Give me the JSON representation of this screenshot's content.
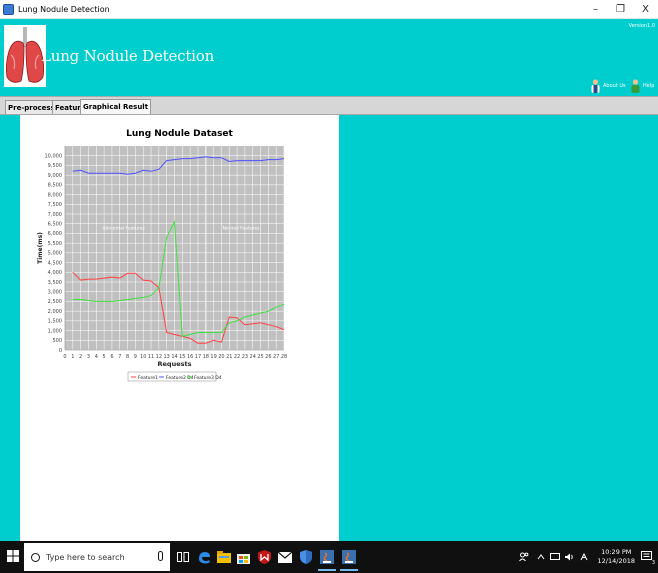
{
  "window": {
    "title": "Lung Nodule Detection",
    "controls": [
      "–",
      "❐",
      "X"
    ]
  },
  "header": {
    "version": "Version1.0",
    "app_title": "Lung Nodule Detection",
    "about_label": "About Us",
    "help_label": "Help"
  },
  "tabs": [
    {
      "label": "Pre-processing",
      "active": false
    },
    {
      "label": "Features",
      "active": false
    },
    {
      "label": "Graphical Result",
      "active": true
    }
  ],
  "chart_data": {
    "type": "line",
    "title": "Lung Nodule Dataset",
    "xlabel": "Requests",
    "ylabel": "Time(ms)",
    "xlim": [
      0,
      28
    ],
    "ylim": [
      0,
      10500
    ],
    "x_ticks": [
      0,
      1,
      2,
      3,
      4,
      5,
      6,
      7,
      8,
      9,
      10,
      11,
      12,
      13,
      14,
      15,
      16,
      17,
      18,
      19,
      20,
      21,
      22,
      23,
      24,
      25,
      26,
      27,
      28
    ],
    "y_ticks": [
      0,
      500,
      1000,
      1500,
      2000,
      2500,
      3000,
      3500,
      4000,
      4500,
      5000,
      5500,
      6000,
      6500,
      7000,
      7500,
      8000,
      8500,
      9000,
      9500,
      10000
    ],
    "y_tick_labels": [
      "0",
      "500",
      "1,000",
      "1,500",
      "2,000",
      "2,500",
      "3,000",
      "3,500",
      "4,000",
      "4,500",
      "5,000",
      "5,500",
      "6,000",
      "6,500",
      "7,000",
      "7,500",
      "8,000",
      "8,500",
      "9,000",
      "9,500",
      "10,000"
    ],
    "grid": true,
    "marker_x": 18,
    "annotations": [
      {
        "text": "Abnormal Features",
        "x": 7.5,
        "y": 6200
      },
      {
        "text": "Normal Features",
        "x": 22.5,
        "y": 6200
      }
    ],
    "legend_position": "bottom",
    "series": [
      {
        "name": "Feature1",
        "color": "#ff4040",
        "x": [
          1,
          2,
          3,
          4,
          5,
          6,
          7,
          8,
          9,
          10,
          11,
          12,
          13,
          14,
          15,
          16,
          17,
          18,
          19,
          20,
          21,
          22,
          23,
          24,
          25,
          26,
          27,
          28
        ],
        "y": [
          4000,
          3600,
          3650,
          3650,
          3700,
          3750,
          3700,
          3950,
          3950,
          3600,
          3550,
          3200,
          900,
          800,
          700,
          600,
          350,
          350,
          500,
          400,
          1700,
          1650,
          1300,
          1350,
          1400,
          1300,
          1200,
          1050
        ]
      },
      {
        "name": "Feature2 D4",
        "color": "#5050ff",
        "x": [
          1,
          2,
          3,
          4,
          5,
          6,
          7,
          8,
          9,
          10,
          11,
          12,
          13,
          14,
          15,
          16,
          17,
          18,
          19,
          20,
          21,
          22,
          23,
          24,
          25,
          26,
          27,
          28
        ],
        "y": [
          9200,
          9250,
          9100,
          9100,
          9100,
          9100,
          9100,
          9050,
          9100,
          9250,
          9200,
          9300,
          9750,
          9800,
          9850,
          9850,
          9900,
          9950,
          9900,
          9900,
          9700,
          9750,
          9750,
          9750,
          9750,
          9800,
          9800,
          9850
        ]
      },
      {
        "name": "Feature3 D4",
        "color": "#40e040",
        "x": [
          1,
          2,
          3,
          4,
          5,
          6,
          7,
          8,
          9,
          10,
          11,
          12,
          13,
          14,
          15,
          16,
          17,
          18,
          19,
          20,
          21,
          22,
          23,
          24,
          25,
          26,
          27,
          28
        ],
        "y": [
          2600,
          2600,
          2550,
          2500,
          2500,
          2500,
          2550,
          2600,
          2650,
          2700,
          2800,
          3200,
          5800,
          6600,
          700,
          800,
          900,
          900,
          900,
          900,
          1400,
          1500,
          1700,
          1800,
          1900,
          2000,
          2200,
          2350
        ]
      }
    ]
  },
  "taskbar": {
    "search_placeholder": "Type here to search",
    "time": "10:29 PM",
    "date": "12/14/2018",
    "tray_icons": [
      "people-icon",
      "chevron-up-icon",
      "network-icon",
      "volume-icon",
      "language-icon"
    ],
    "notification_count": "3"
  }
}
